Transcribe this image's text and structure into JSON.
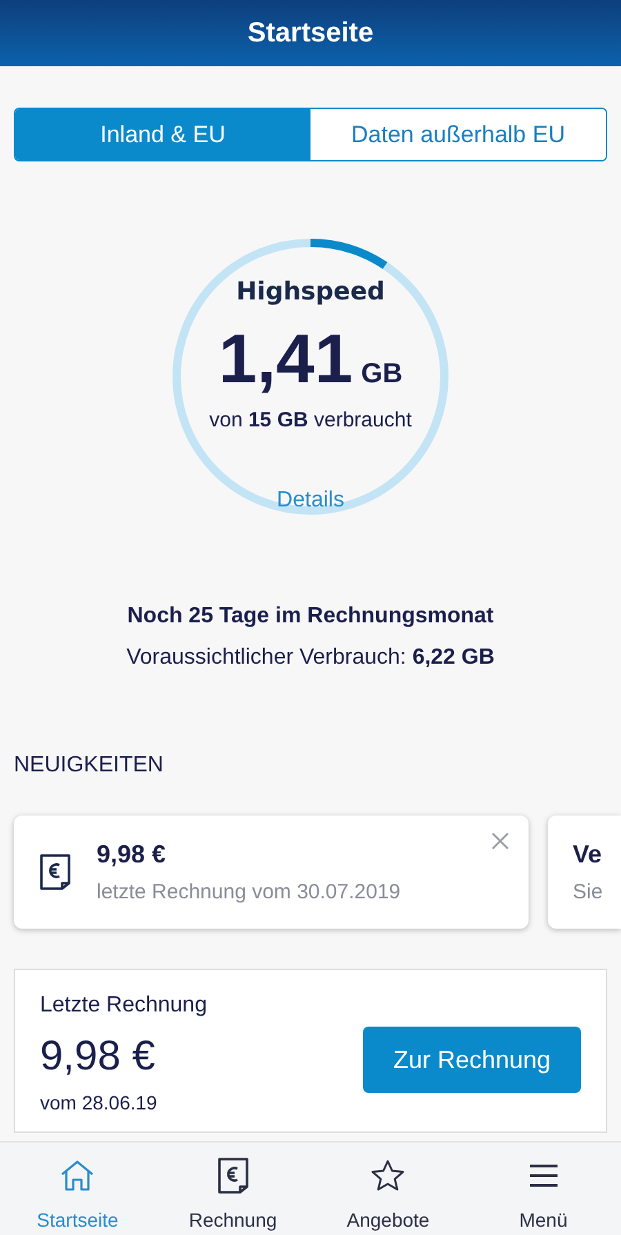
{
  "header": {
    "title": "Startseite"
  },
  "tabs": [
    {
      "label": "Inland & EU",
      "selected": true
    },
    {
      "label": "Daten außerhalb EU",
      "selected": false
    }
  ],
  "usage": {
    "title": "Highspeed",
    "amount": "1,41",
    "unit": "GB",
    "caption": "von **15 GB** verbraucht",
    "link": "Details",
    "level": 0.094
  },
  "period": {
    "remaining": "Noch 25 Tage im Rechnungsmonat",
    "forecast": "Voraussichtlicher Verbrauch: **6,22 GB**"
  },
  "news": {
    "heading": "NEUIGKEITEN",
    "cards": [
      {
        "kind": "invoice",
        "title": "9,98 €",
        "subtitle": "letzte Rechnung vom 30.07.2019"
      },
      {
        "kind": "plain",
        "title": "Ve",
        "subtitle": "Sie"
      }
    ]
  },
  "last_invoice": {
    "label": "Letzte Rechnung",
    "amount": "9,98 €",
    "date": "vom 28.06.19",
    "button": "Zur Rechnung"
  },
  "nav": [
    {
      "kind": "home",
      "label": "Startseite",
      "selected": true
    },
    {
      "kind": "invoice",
      "label": "Rechnung",
      "selected": false
    },
    {
      "kind": "star",
      "label": "Angebote",
      "selected": false
    },
    {
      "kind": "menu",
      "label": "Menü",
      "selected": false
    }
  ]
}
